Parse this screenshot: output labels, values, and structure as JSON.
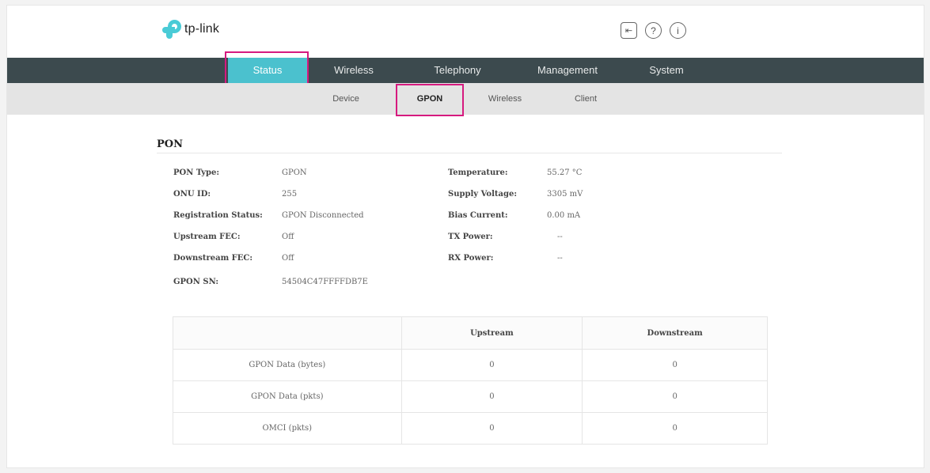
{
  "brand": {
    "logo_text": "tp-link",
    "accent": "#4bc1ce",
    "nav_bg": "#3c4a4e",
    "highlight": "#d61a7f"
  },
  "header_icons": [
    {
      "name": "logout-icon",
      "glyph": "⇤"
    },
    {
      "name": "help-icon",
      "glyph": "?"
    },
    {
      "name": "info-icon",
      "glyph": "i"
    }
  ],
  "main_nav": {
    "active": "Status",
    "items": [
      "Status",
      "Wireless",
      "Telephony",
      "Management",
      "System"
    ]
  },
  "sub_nav": {
    "active": "GPON",
    "items": [
      "Device",
      "GPON",
      "Wireless",
      "Client"
    ]
  },
  "pon": {
    "title": "PON",
    "left": [
      {
        "label": "PON Type:",
        "value": "GPON"
      },
      {
        "label": "ONU ID:",
        "value": "255"
      },
      {
        "label": "Registration Status:",
        "value": "GPON Disconnected"
      },
      {
        "label": "Upstream FEC:",
        "value": "Off"
      },
      {
        "label": "Downstream FEC:",
        "value": "Off"
      },
      {
        "label": "GPON SN:",
        "value": "54504C47FFFFDB7E"
      }
    ],
    "right": [
      {
        "label": "Temperature:",
        "value": "55.27 °C"
      },
      {
        "label": "Supply Voltage:",
        "value": "3305 mV"
      },
      {
        "label": "Bias Current:",
        "value": "0.00 mA"
      },
      {
        "label": "TX Power:",
        "value": "--"
      },
      {
        "label": "RX Power:",
        "value": "--"
      }
    ]
  },
  "stats_table": {
    "headers": [
      "",
      "Upstream",
      "Downstream"
    ],
    "rows": [
      [
        "GPON Data (bytes)",
        "0",
        "0"
      ],
      [
        "GPON Data (pkts)",
        "0",
        "0"
      ],
      [
        "OMCI (pkts)",
        "0",
        "0"
      ]
    ]
  }
}
